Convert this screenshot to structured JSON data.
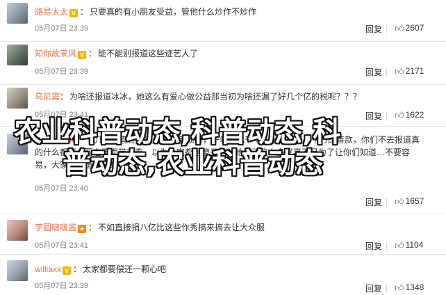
{
  "comments": [
    {
      "username": "路易太太",
      "verified": true,
      "separator": "：",
      "text": "只要真的有小朋友受益，管他什么炒作不炒作",
      "time": "05月07日 23:39",
      "reply_label": "回复",
      "likes": "2607"
    },
    {
      "username": "知你故来风",
      "verified": true,
      "separator": "：",
      "text": "能不能别报道这些迹艺人了",
      "time": "05月07日 23:39",
      "reply_label": "回复",
      "likes": "2171"
    },
    {
      "username": "乌尼窦",
      "verified": false,
      "separator": "：",
      "text": "为啥还报道冰冰，她这么有爱心做公益那当初为啥还漏了好几个亿的税呢？？？",
      "time": "05月07日 23:41",
      "reply_label": "回复",
      "likes": "1622"
    },
    {
      "username": "Comicloom",
      "verified": false,
      "separator": "：",
      "text": "十几年一直在默默地做慈善项目，一年好几千个，十几年来几千万的善款，你们不去报道真的什么都不…要在下面带节奏，以为大家都是傻子吗？她做了这么多好事不是为了让你们知道…不要容易，大家都知道（！！！",
      "time": "05月07日 23:40",
      "reply_label": "回复",
      "likes": "1657"
    },
    {
      "username": "芋圆啵啵酱",
      "verified": false,
      "separator": "：",
      "text": "不如直接捐八亿比这些作秀搞来搞去让大众服",
      "time": "05月07日 23:41",
      "reply_label": "回复",
      "likes": "1104"
    },
    {
      "username": "williaxx",
      "verified": true,
      "separator": "：",
      "text": "太家都要偿还一颗心吧",
      "time": "05月07日 23:39",
      "reply_label": "回复",
      "likes": "1348"
    }
  ],
  "overlay": {
    "line1": "农业科普动态,科普动态,科",
    "line2": "普动态,农业科普动态"
  },
  "colors": {
    "username": "#eb7350",
    "verified_badge": "#f4b400",
    "time": "#808080"
  },
  "icons": {
    "verified": "verified-v-icon",
    "like": "thumbs-up-icon"
  }
}
